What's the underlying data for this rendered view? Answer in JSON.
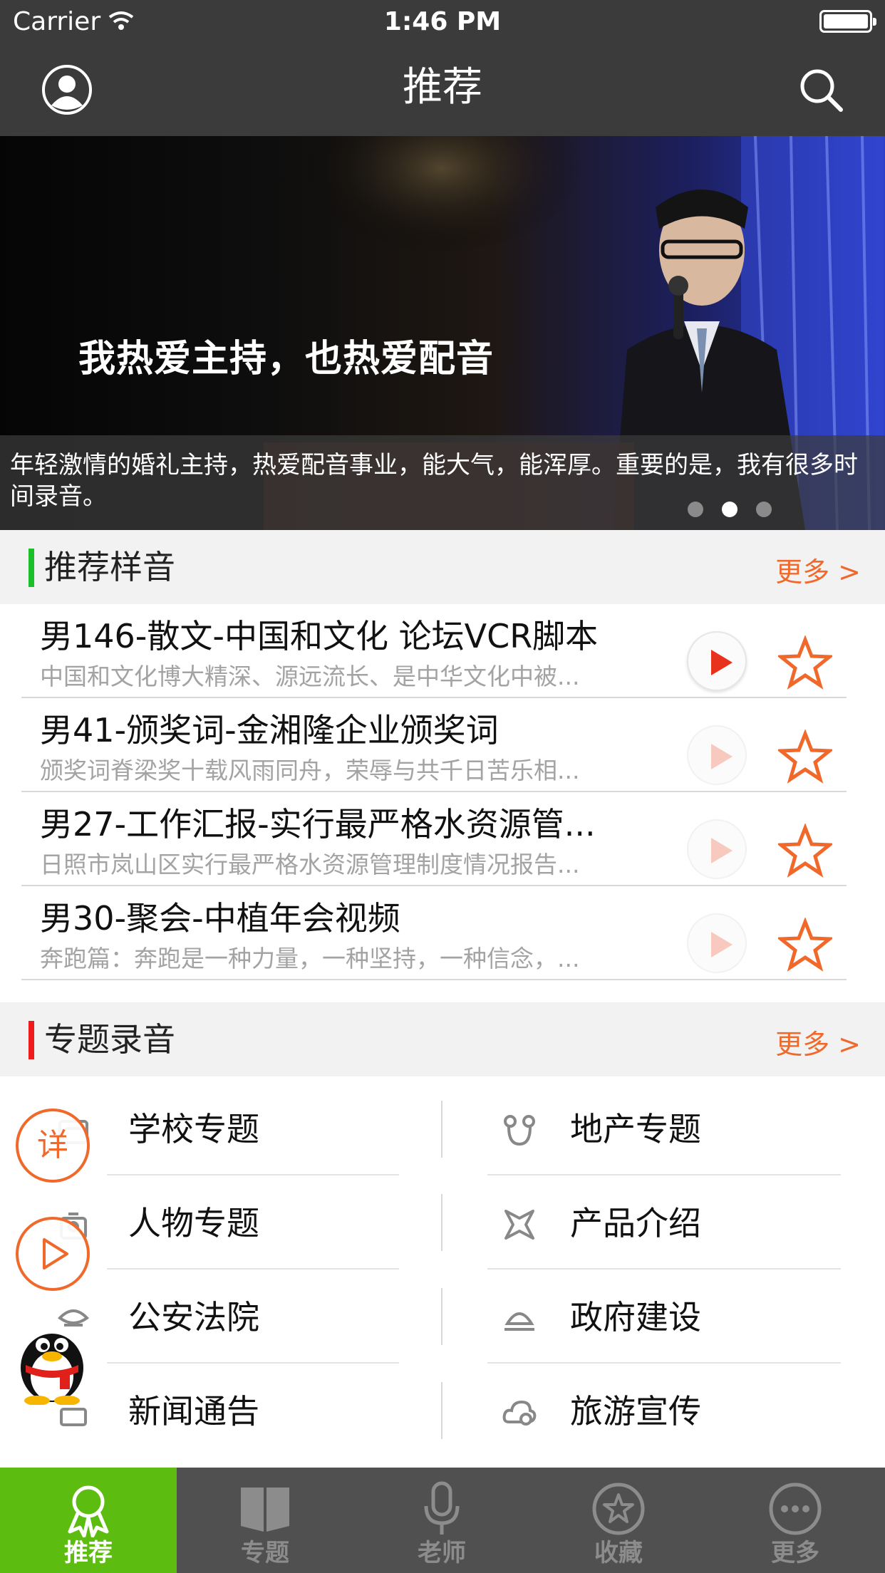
{
  "status_bar": {
    "carrier": "Carrier",
    "time": "1:46 PM"
  },
  "nav": {
    "title": "推荐"
  },
  "banner": {
    "headline": "我热爱主持，也热爱配音",
    "caption": "年轻激情的婚礼主持，热爱配音事业，能大气，能浑厚。重要的是，我有很多时间录音。",
    "page_count": 3,
    "active_page": 2
  },
  "recommended": {
    "title": "推荐样音",
    "more": "更多 >",
    "accent": "#1bbf2a",
    "items": [
      {
        "title": "男146-散文-中国和文化   论坛VCR脚本",
        "subtitle": "中国和文化博大精深、源远流长、是中华文化中被...",
        "playing": true
      },
      {
        "title": "男41-颁奖词-金湘隆企业颁奖词",
        "subtitle": "颁奖词脊梁奖十载风雨同舟，荣辱与共千日苦乐相...",
        "playing": false
      },
      {
        "title": "男27-工作汇报-实行最严格水资源管...",
        "subtitle": "日照市岚山区实行最严格水资源管理制度情况报告...",
        "playing": false
      },
      {
        "title": "男30-聚会-中植年会视频",
        "subtitle": "奔跑篇：奔跑是一种力量，一种坚持，一种信念，...",
        "playing": false
      }
    ]
  },
  "topics": {
    "title": "专题录音",
    "more": "更多 >",
    "accent": "#ee1c1c",
    "left": [
      {
        "label": "学校专题",
        "icon": "school-icon"
      },
      {
        "label": "人物专题",
        "icon": "person-icon"
      },
      {
        "label": "公安法院",
        "icon": "police-icon"
      },
      {
        "label": "新闻通告",
        "icon": "news-icon"
      }
    ],
    "right": [
      {
        "label": "地产专题",
        "icon": "realestate-icon"
      },
      {
        "label": "产品介绍",
        "icon": "product-icon"
      },
      {
        "label": "政府建设",
        "icon": "government-icon"
      },
      {
        "label": "旅游宣传",
        "icon": "travel-icon"
      }
    ]
  },
  "floating": {
    "detail_label": "详"
  },
  "tabbar": {
    "active_color": "#5cbd10",
    "items": [
      {
        "label": "推荐",
        "icon": "award-icon",
        "active": true
      },
      {
        "label": "专题",
        "icon": "book-icon",
        "active": false
      },
      {
        "label": "老师",
        "icon": "microphone-icon",
        "active": false
      },
      {
        "label": "收藏",
        "icon": "star-circle-icon",
        "active": false
      },
      {
        "label": "更多",
        "icon": "more-dots-icon",
        "active": false
      }
    ]
  },
  "colors": {
    "accent_orange": "#f0692b",
    "play_red": "#e8321b",
    "nav_bg": "#3b3b3b"
  }
}
